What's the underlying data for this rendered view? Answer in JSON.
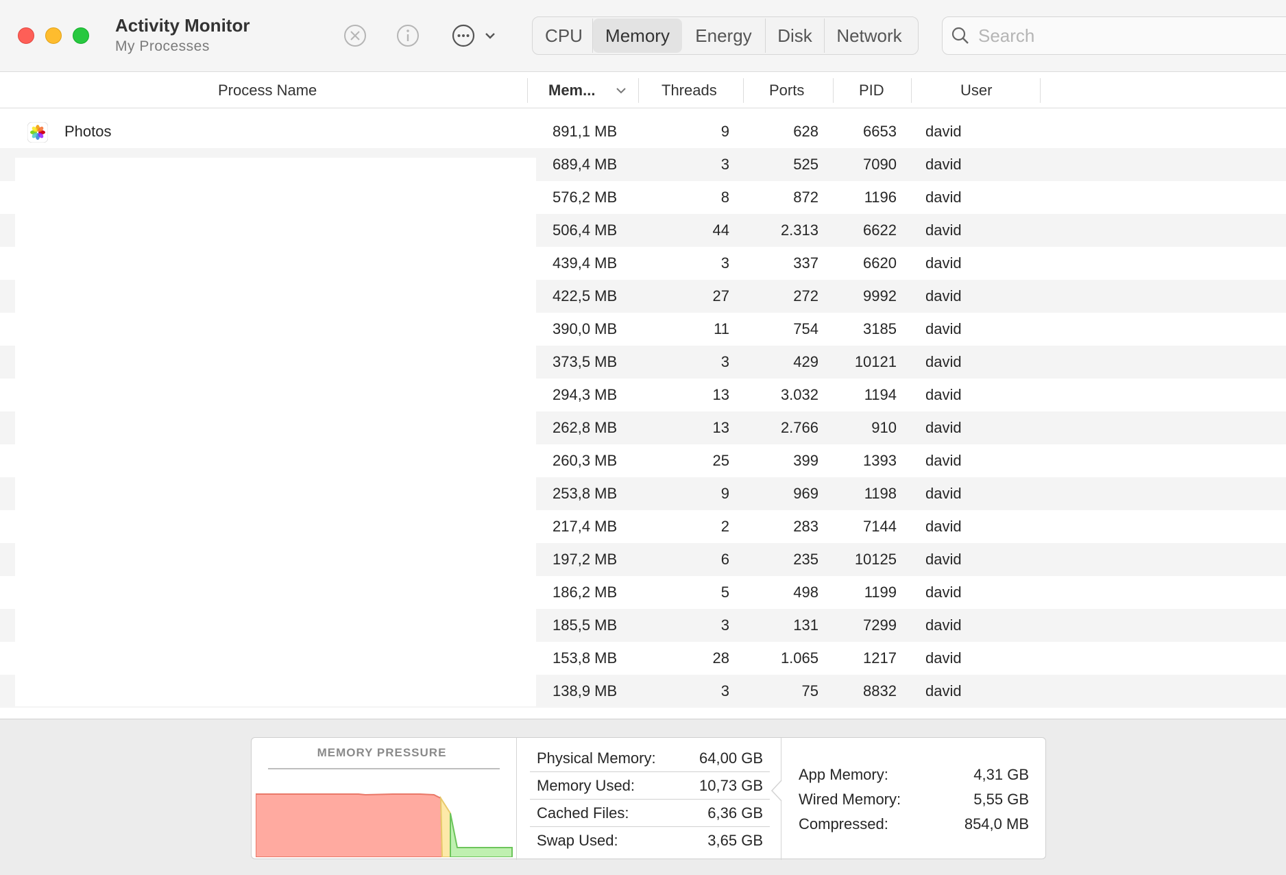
{
  "window": {
    "title": "Activity Monitor",
    "subtitle": "My Processes"
  },
  "toolbar": {
    "stop_icon": "stop-process-icon",
    "info_icon": "info-icon",
    "more_icon": "more-options-icon",
    "tabs": [
      {
        "label": "CPU",
        "active": false
      },
      {
        "label": "Memory",
        "active": true
      },
      {
        "label": "Energy",
        "active": false
      },
      {
        "label": "Disk",
        "active": false
      },
      {
        "label": "Network",
        "active": false
      }
    ],
    "search_placeholder": "Search"
  },
  "table": {
    "headers": {
      "name": "Process Name",
      "memory": "Mem...",
      "threads": "Threads",
      "ports": "Ports",
      "pid": "PID",
      "user": "User"
    },
    "rows": [
      {
        "name": "Photos",
        "memory": "891,1 MB",
        "threads": "9",
        "ports": "628",
        "pid": "6653",
        "user": "david"
      },
      {
        "name": "",
        "memory": "689,4 MB",
        "threads": "3",
        "ports": "525",
        "pid": "7090",
        "user": "david"
      },
      {
        "name": "",
        "memory": "576,2 MB",
        "threads": "8",
        "ports": "872",
        "pid": "1196",
        "user": "david"
      },
      {
        "name": "",
        "memory": "506,4 MB",
        "threads": "44",
        "ports": "2.313",
        "pid": "6622",
        "user": "david"
      },
      {
        "name": "",
        "memory": "439,4 MB",
        "threads": "3",
        "ports": "337",
        "pid": "6620",
        "user": "david"
      },
      {
        "name": "",
        "memory": "422,5 MB",
        "threads": "27",
        "ports": "272",
        "pid": "9992",
        "user": "david"
      },
      {
        "name": "",
        "memory": "390,0 MB",
        "threads": "11",
        "ports": "754",
        "pid": "3185",
        "user": "david"
      },
      {
        "name": "",
        "memory": "373,5 MB",
        "threads": "3",
        "ports": "429",
        "pid": "10121",
        "user": "david"
      },
      {
        "name": "",
        "memory": "294,3 MB",
        "threads": "13",
        "ports": "3.032",
        "pid": "1194",
        "user": "david"
      },
      {
        "name": "",
        "memory": "262,8 MB",
        "threads": "13",
        "ports": "2.766",
        "pid": "910",
        "user": "david"
      },
      {
        "name": "",
        "memory": "260,3 MB",
        "threads": "25",
        "ports": "399",
        "pid": "1393",
        "user": "david"
      },
      {
        "name": "",
        "memory": "253,8 MB",
        "threads": "9",
        "ports": "969",
        "pid": "1198",
        "user": "david"
      },
      {
        "name": "",
        "memory": "217,4 MB",
        "threads": "2",
        "ports": "283",
        "pid": "7144",
        "user": "david"
      },
      {
        "name": "",
        "memory": "197,2 MB",
        "threads": "6",
        "ports": "235",
        "pid": "10125",
        "user": "david"
      },
      {
        "name": "",
        "memory": "186,2 MB",
        "threads": "5",
        "ports": "498",
        "pid": "1199",
        "user": "david"
      },
      {
        "name": "",
        "memory": "185,5 MB",
        "threads": "3",
        "ports": "131",
        "pid": "7299",
        "user": "david"
      },
      {
        "name": "",
        "memory": "153,8 MB",
        "threads": "28",
        "ports": "1.065",
        "pid": "1217",
        "user": "david"
      },
      {
        "name": "",
        "memory": "138,9 MB",
        "threads": "3",
        "ports": "75",
        "pid": "8832",
        "user": "david"
      }
    ]
  },
  "footer": {
    "pressure_title": "MEMORY PRESSURE",
    "pressure_colors": {
      "red": "#ffaaa0",
      "yellow": "#fde9a8",
      "green": "#bff0b0"
    },
    "middle_stats": [
      {
        "label": "Physical Memory:",
        "value": "64,00 GB"
      },
      {
        "label": "Memory Used:",
        "value": "10,73 GB"
      },
      {
        "label": "Cached Files:",
        "value": "6,36 GB"
      },
      {
        "label": "Swap Used:",
        "value": "3,65 GB"
      }
    ],
    "right_stats": [
      {
        "label": "App Memory:",
        "value": "4,31 GB"
      },
      {
        "label": "Wired Memory:",
        "value": "5,55 GB"
      },
      {
        "label": "Compressed:",
        "value": "854,0 MB"
      }
    ]
  }
}
